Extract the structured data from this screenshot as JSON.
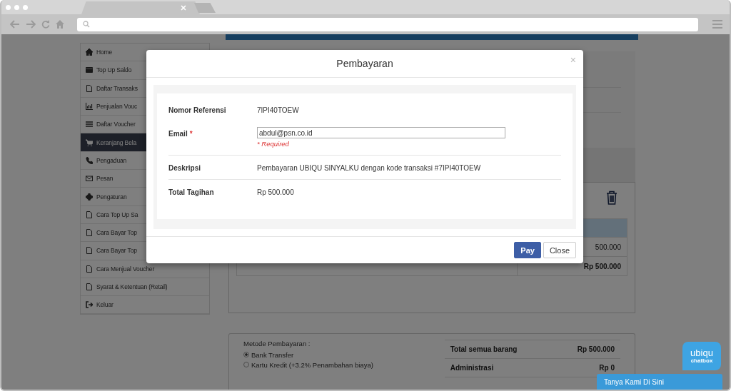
{
  "sidebar": {
    "items": [
      {
        "label": "Home",
        "selected": false
      },
      {
        "label": "Top Up Saldo",
        "selected": false
      },
      {
        "label": "Daftar Transaks",
        "selected": false
      },
      {
        "label": "Penjualan Vouc",
        "selected": false
      },
      {
        "label": "Daftar Voucher",
        "selected": false
      },
      {
        "label": "Keranjang Bela",
        "selected": true
      },
      {
        "label": "Pengaduan",
        "selected": false
      },
      {
        "label": "Pesan",
        "selected": false
      },
      {
        "label": "Pengaturan",
        "selected": false
      },
      {
        "label": "Cara Top Up Sa",
        "selected": false
      },
      {
        "label": "Cara Bayar Top",
        "selected": false
      },
      {
        "label": "Cara Bayar Top",
        "selected": false
      },
      {
        "label": "Cara Menjual Voucher",
        "selected": false
      },
      {
        "label": "Syarat & Ketentuan (Retail)",
        "selected": false
      },
      {
        "label": "Keluar",
        "selected": false
      }
    ]
  },
  "cart": {
    "subtotal": "500.000",
    "total": "Rp 500.000"
  },
  "payment": {
    "label": "Metode Pembayaran :",
    "options": [
      {
        "label": "Bank Transfer",
        "selected": true
      },
      {
        "label": "Kartu Kredit (+3.2% Penambahan biaya)",
        "selected": false
      }
    ],
    "summary": [
      {
        "label": "Total semua barang",
        "value": "Rp 500.000"
      },
      {
        "label": "Administrasi",
        "value": "Rp 0"
      }
    ]
  },
  "modal": {
    "title": "Pembayaran",
    "close": "×",
    "fields": [
      {
        "kind": "text",
        "label": "Nomor Referensi",
        "value": "7IPI40TOEW",
        "divider": false
      },
      {
        "kind": "input",
        "label": "Email",
        "required_mark": "*",
        "value": "abdul@psn.co.id",
        "error": "* Required",
        "divider": true
      },
      {
        "kind": "text",
        "label": "Deskripsi",
        "value": "Pembayaran UBIQU SINYALKU dengan kode transaksi #7IPI40TOEW",
        "divider": true
      },
      {
        "kind": "text",
        "label": "Total Tagihan",
        "value": "Rp 500.000",
        "divider": false
      }
    ],
    "buttons": [
      {
        "kind": "primary",
        "label": "Pay"
      },
      {
        "kind": "default",
        "label": "Close"
      }
    ]
  },
  "chat": {
    "logo": "ubiqu",
    "logo_sub": "chatbox",
    "cta": "Tanya Kami Di Sini"
  }
}
